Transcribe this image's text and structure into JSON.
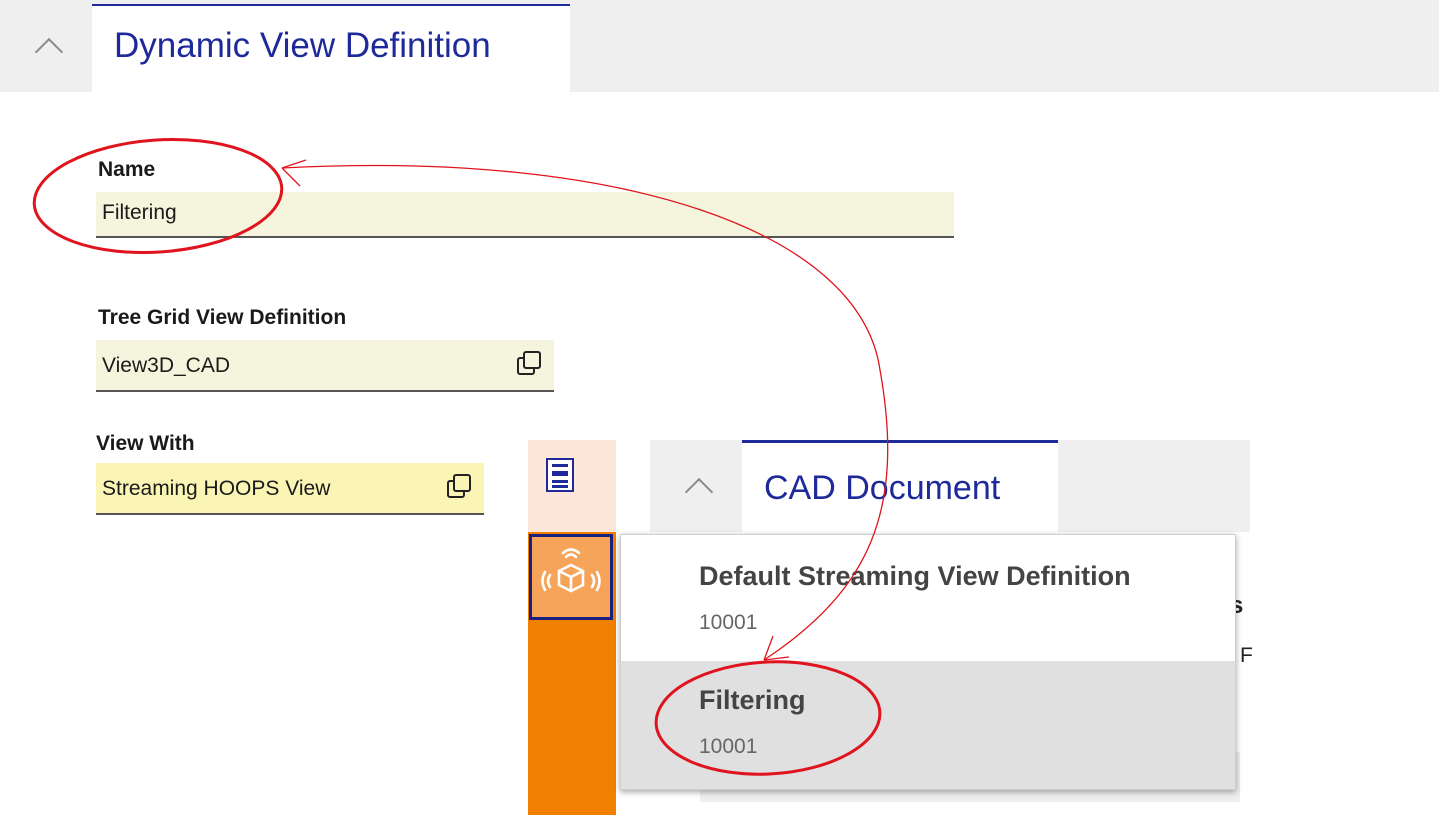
{
  "header": {
    "title": "Dynamic View Definition"
  },
  "form": {
    "name_label": "Name",
    "name_value": "Filtering",
    "tree_label": "Tree Grid View Definition",
    "tree_value": "View3D_CAD",
    "viewwith_label": "View With",
    "viewwith_value": "Streaming HOOPS View"
  },
  "cad_panel": {
    "title": "CAD Document",
    "partial_text_1": "s",
    "partial_text_2": "F"
  },
  "dropdown": {
    "options": [
      {
        "name": "Default Streaming View Definition",
        "number": "10001"
      },
      {
        "name": "Filtering",
        "number": "10001"
      }
    ]
  },
  "colors": {
    "accent": "#1f2a9a",
    "annotation": "#e0141e",
    "strip_orange": "#f28000"
  },
  "icons": [
    "chevron-up-icon",
    "copy-icon",
    "form-icon",
    "streaming-cube-icon"
  ]
}
